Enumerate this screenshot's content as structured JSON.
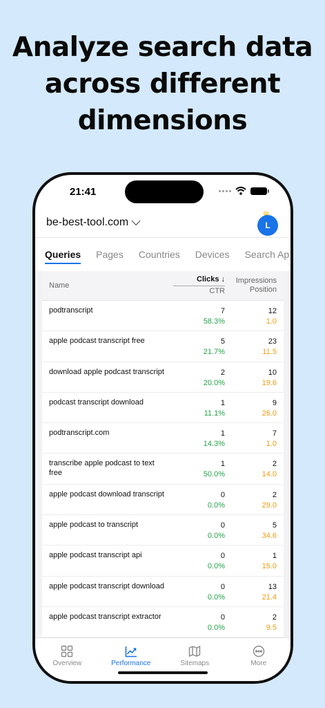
{
  "headline": [
    "Analyze search data",
    "across different",
    "dimensions"
  ],
  "status": {
    "time": "21:41"
  },
  "site": {
    "name": "be-best-tool.com"
  },
  "avatar": {
    "initial": "L"
  },
  "tabs": [
    {
      "label": "Queries",
      "active": true
    },
    {
      "label": "Pages",
      "active": false
    },
    {
      "label": "Countries",
      "active": false
    },
    {
      "label": "Devices",
      "active": false
    },
    {
      "label": "Search Ap",
      "active": false
    }
  ],
  "table": {
    "headers": {
      "name": "Name",
      "clicks": "Clicks ↓",
      "ctr": "CTR",
      "impressions": "Impressions",
      "position": "Position"
    },
    "rows": [
      {
        "name": "podtranscript",
        "clicks": "7",
        "ctr": "58.3%",
        "impressions": "12",
        "position": "1.0"
      },
      {
        "name": "apple podcast transcript free",
        "clicks": "5",
        "ctr": "21.7%",
        "impressions": "23",
        "position": "11.5"
      },
      {
        "name": "download apple podcast transcript",
        "clicks": "2",
        "ctr": "20.0%",
        "impressions": "10",
        "position": "19.6"
      },
      {
        "name": "podcast transcript download",
        "clicks": "1",
        "ctr": "11.1%",
        "impressions": "9",
        "position": "26.0"
      },
      {
        "name": "podtranscript.com",
        "clicks": "1",
        "ctr": "14.3%",
        "impressions": "7",
        "position": "1.0"
      },
      {
        "name": "transcribe apple podcast to text free",
        "clicks": "1",
        "ctr": "50.0%",
        "impressions": "2",
        "position": "14.0"
      },
      {
        "name": "apple podcast download transcript",
        "clicks": "0",
        "ctr": "0.0%",
        "impressions": "2",
        "position": "29.0"
      },
      {
        "name": "apple podcast to transcript",
        "clicks": "0",
        "ctr": "0.0%",
        "impressions": "5",
        "position": "34.6"
      },
      {
        "name": "apple podcast transcript api",
        "clicks": "0",
        "ctr": "0.0%",
        "impressions": "1",
        "position": "15.0"
      },
      {
        "name": "apple podcast transcript download",
        "clicks": "0",
        "ctr": "0.0%",
        "impressions": "13",
        "position": "21.4"
      },
      {
        "name": "apple podcast transcript extractor",
        "clicks": "0",
        "ctr": "0.0%",
        "impressions": "2",
        "position": "9.5"
      }
    ]
  },
  "nav": [
    {
      "label": "Overview",
      "icon": "grid-icon",
      "active": false
    },
    {
      "label": "Performance",
      "icon": "trending-up-icon",
      "active": true
    },
    {
      "label": "Sitemaps",
      "icon": "map-icon",
      "active": false
    },
    {
      "label": "More",
      "icon": "more-circle-icon",
      "active": false
    }
  ],
  "colors": {
    "accent": "#1a73e8",
    "ctr": "#22a447",
    "position": "#f29a0f",
    "background": "#d4e9fb"
  }
}
